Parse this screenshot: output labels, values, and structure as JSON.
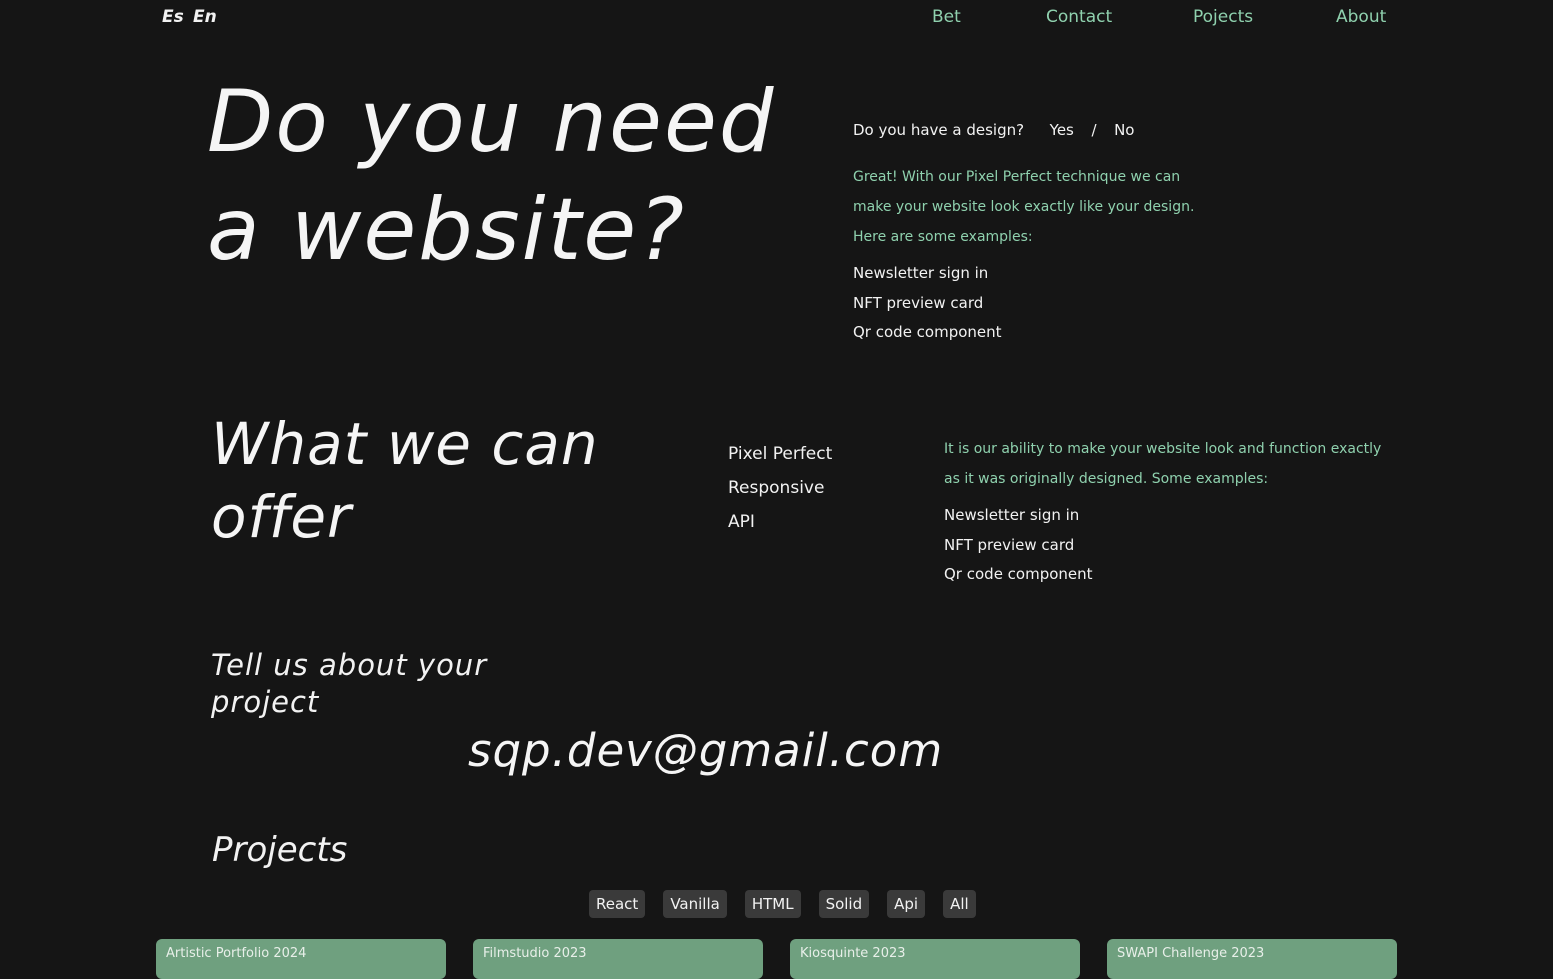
{
  "header": {
    "languages": [
      "Es",
      "En"
    ],
    "nav": [
      "Bet",
      "Contact",
      "Pojects",
      "About"
    ]
  },
  "hero": {
    "title_line1": "Do you need",
    "title_line2": "a website?",
    "question": "Do you have a design?",
    "yes": "Yes",
    "separator": "/",
    "no": "No",
    "answer_lines": [
      "Great! With our Pixel Perfect technique we can",
      "make your website look exactly like your design.",
      "Here are some examples:"
    ],
    "examples": [
      "Newsletter sign in",
      "NFT preview card",
      "Qr code component"
    ]
  },
  "offer": {
    "title_line1": "What we can",
    "title_line2": "offer",
    "items": [
      "Pixel Perfect",
      "Responsive",
      "API"
    ],
    "description_lines": [
      "It is our ability to make your website look and function exactly",
      "as it was originally designed. Some examples:"
    ],
    "examples": [
      "Newsletter sign in",
      "NFT preview card",
      "Qr code component"
    ]
  },
  "contact": {
    "title_line1": "Tell us about your",
    "title_line2": "project",
    "email": "sqp.dev@gmail.com"
  },
  "projects": {
    "title": "Projects",
    "filters": [
      "React",
      "Vanilla",
      "HTML",
      "Solid",
      "Api",
      "All"
    ],
    "cards": [
      "Artistic Portfolio 2024",
      "Filmstudio 2023",
      "Kiosquinte 2023",
      "SWAPI Challenge 2023"
    ]
  },
  "colors": {
    "background": "#151515",
    "accent": "#8fd1ae",
    "chip": "#3a3a3a",
    "card": "#6fa07f"
  }
}
